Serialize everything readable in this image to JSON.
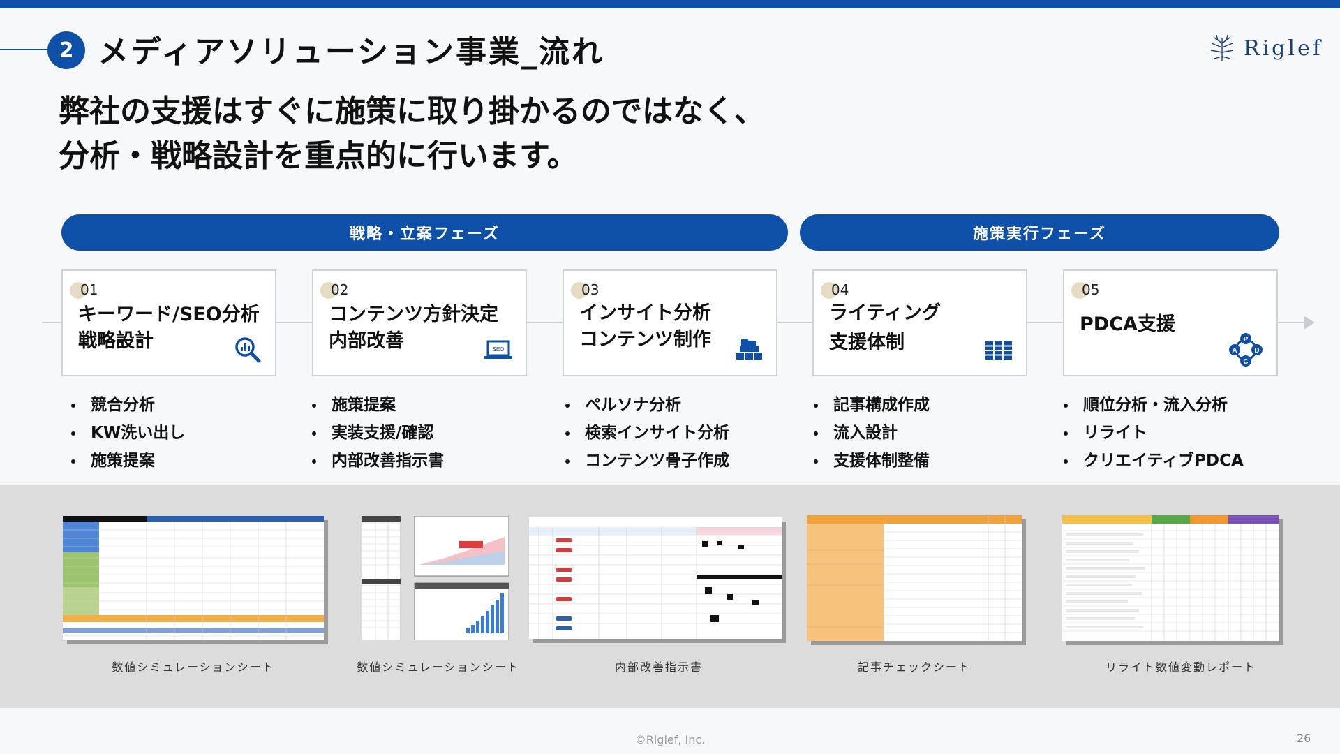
{
  "header": {
    "section_number": "2",
    "section_title": "メディアソリューション事業_流れ",
    "logo_text": "Riglef"
  },
  "headline": {
    "line1": "弊社の支援はすぐに施策に取り掛かるのではなく、",
    "line2": "分析・戦略設計を重点的に行います。"
  },
  "phases": {
    "strategy": "戦略・立案フェーズ",
    "execution": "施策実行フェーズ"
  },
  "steps": [
    {
      "num": "01",
      "title1": "キーワード/SEO分析",
      "title2": "戦略設計",
      "icon": "magnifier-chart-icon",
      "bullets": [
        "競合分析",
        "KW洗い出し",
        "施策提案"
      ]
    },
    {
      "num": "02",
      "title1": "コンテンツ方針決定",
      "title2": "内部改善",
      "icon": "seo-laptop-icon",
      "icon_text": "SEO",
      "bullets": [
        "施策提案",
        "実装支援/確認",
        "内部改善指示書"
      ]
    },
    {
      "num": "03",
      "title1": "インサイト分析",
      "title2": "コンテンツ制作",
      "icon": "folder-boxes-icon",
      "bullets": [
        "ペルソナ分析",
        "検索インサイト分析",
        "コンテンツ骨子作成"
      ]
    },
    {
      "num": "04",
      "title1": "ライティング",
      "title2": "支援体制",
      "icon": "grid-table-icon",
      "bullets": [
        "記事構成作成",
        "流入設計",
        "支援体制整備"
      ]
    },
    {
      "num": "05",
      "title1": "PDCA支援",
      "title2": "",
      "icon": "pdca-cycle-icon",
      "icon_letters": [
        "P",
        "D",
        "C",
        "A"
      ],
      "bullets": [
        "順位分析・流入分析",
        "リライト",
        "クリエイティブPDCA"
      ]
    }
  ],
  "gallery": [
    {
      "caption": "数値シミュレーションシート"
    },
    {
      "caption": "数値シミュレーションシート"
    },
    {
      "caption": "内部改善指示書"
    },
    {
      "caption": "記事チェックシート"
    },
    {
      "caption": "リライト数値変動レポート"
    }
  ],
  "footer": {
    "copyright": "©Riglef, Inc.",
    "page_number": "26"
  },
  "colors": {
    "brand_blue": "#0e4fa8",
    "card_border": "#cfd2d6",
    "gallery_bg": "#dcdcdc",
    "number_dot": "#e6dcc3"
  }
}
